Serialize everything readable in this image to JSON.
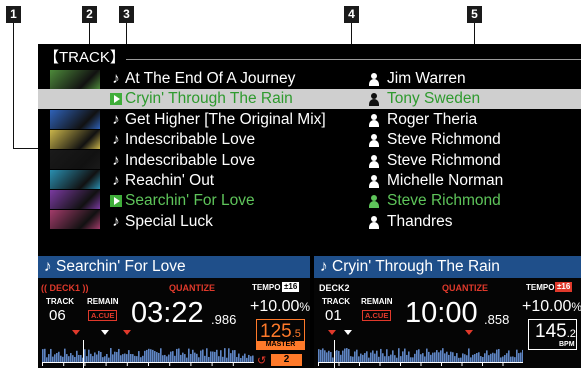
{
  "callouts": [
    "1",
    "2",
    "3",
    "4",
    "5"
  ],
  "browser": {
    "title": "【TRACK】",
    "selected_index": 1,
    "tracks": [
      {
        "title": "At The End Of A Journey",
        "artist": "Jim Warren",
        "icon": "music-note-icon",
        "state": "normal"
      },
      {
        "title": "Cryin' Through The Rain",
        "artist": "Tony Sweden",
        "icon": "play-icon",
        "state": "selected"
      },
      {
        "title": "Get Higher [The Original Mix]",
        "artist": "Roger Theria",
        "icon": "music-note-icon",
        "state": "normal"
      },
      {
        "title": "Indescribable Love",
        "artist": "Steve Richmond",
        "icon": "music-note-icon",
        "state": "normal"
      },
      {
        "title": "Indescribable Love",
        "artist": "Steve Richmond",
        "icon": "music-note-icon",
        "state": "normal"
      },
      {
        "title": "Reachin' Out",
        "artist": "Michelle Norman",
        "icon": "music-note-icon",
        "state": "normal"
      },
      {
        "title": "Searchin' For Love",
        "artist": "Steve Richmond",
        "icon": "play-icon",
        "state": "loaded"
      },
      {
        "title": "Special Luck",
        "artist": "Thandres",
        "icon": "music-note-icon",
        "state": "normal"
      }
    ],
    "artwork_colors": [
      "#4d8a3a",
      "#c0407a",
      "#2f62b8",
      "#c9b44a",
      "#1a1a1a",
      "#2a8fb0",
      "#7a3aa0",
      "#a23b6a"
    ]
  },
  "decks": [
    {
      "title": "♪ Searchin' For Love",
      "deck_label": "(( DECK1 ))",
      "quantize": "QUANTIZE",
      "tempo_label": "TEMPO",
      "tempo_range": "±16",
      "track_label": "TRACK",
      "track_number": "06",
      "remain_label": "REMAIN",
      "acue": "A.CUE",
      "time": "03:22",
      "time_ms": ".986",
      "tempo": "+10.00",
      "tempo_unit": "%",
      "bpm_int": "125",
      "bpm_dec": ".5",
      "bpm_tag": "MASTER",
      "sync_number": "2"
    },
    {
      "title": "♪ Cryin' Through The Rain",
      "deck_label": "DECK2",
      "quantize": "QUANTIZE",
      "tempo_label": "TEMPO",
      "tempo_range": "±16",
      "track_label": "TRACK",
      "track_number": "01",
      "remain_label": "REMAIN",
      "acue": "A.CUE",
      "time": "10:00",
      "time_ms": ".858",
      "tempo": "+10.00",
      "tempo_unit": "%",
      "bpm_int": "145",
      "bpm_dec": ".2",
      "bpm_tag": "BPM"
    }
  ],
  "colors": {
    "accent_green": "#5ec45a",
    "selected_row": "#cfcfcf",
    "deck_header": "#1f4f8a",
    "warning_red": "#e0392b",
    "bpm_master": "#ff7a2a",
    "waveform": "#5f86c4"
  }
}
